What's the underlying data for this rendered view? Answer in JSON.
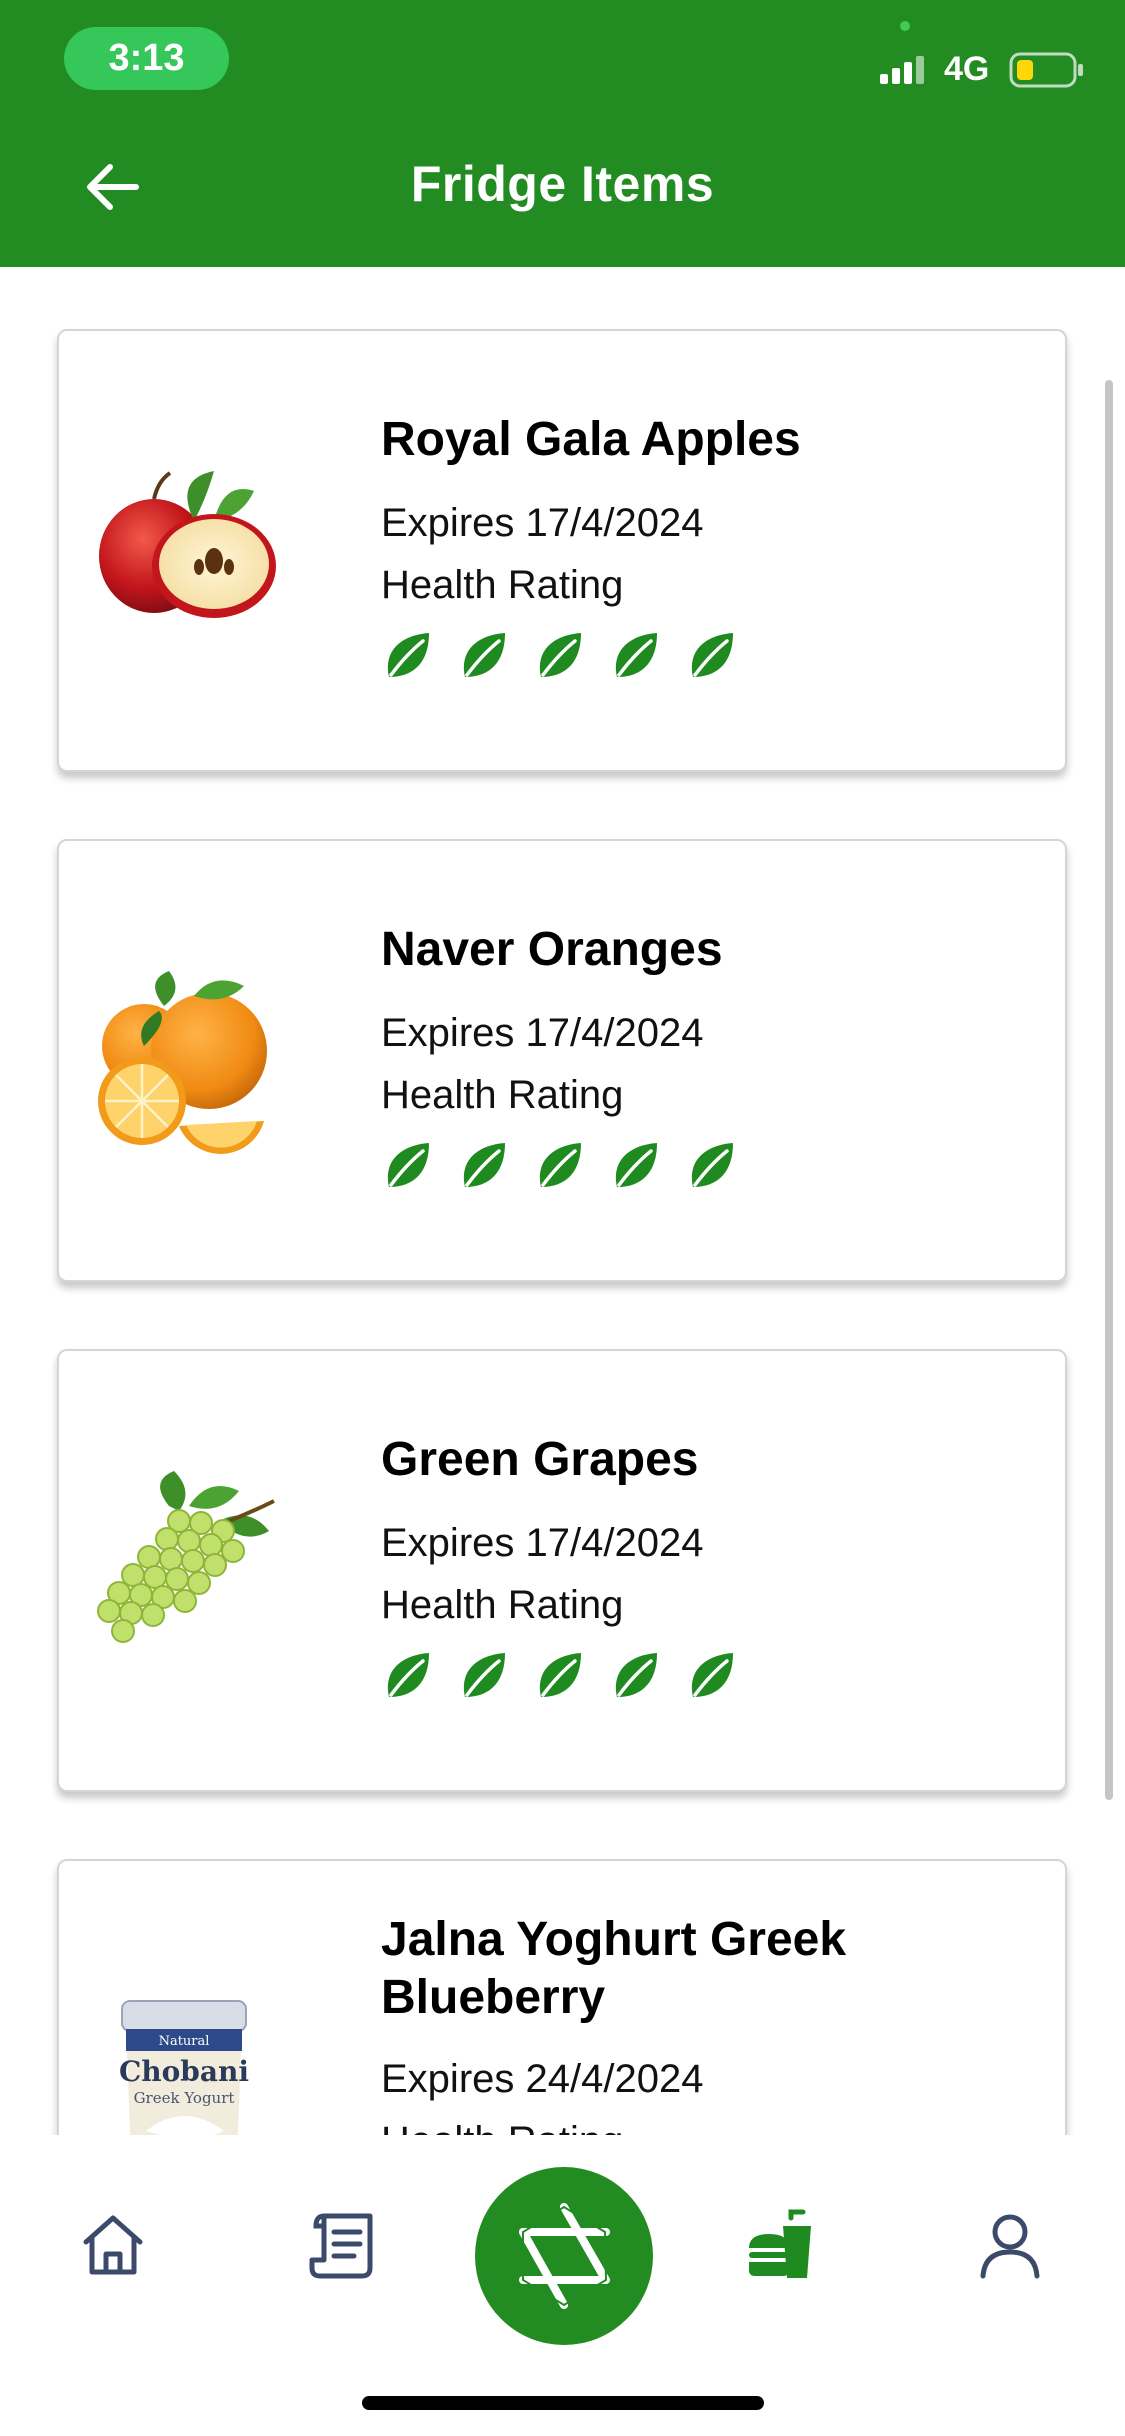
{
  "status_bar": {
    "time": "3:13",
    "network": "4G"
  },
  "header": {
    "title": "Fridge Items"
  },
  "colors": {
    "brand_green": "#228B22",
    "leaf_green": "#1f8a1f",
    "nav_icon": "#3b4a6b"
  },
  "items": [
    {
      "name": "Royal Gala Apples",
      "expires": "Expires 17/4/2024",
      "rating_label": "Health Rating",
      "health_rating": 5,
      "image": "apple-image"
    },
    {
      "name": "Naver Oranges",
      "expires": "Expires 17/4/2024",
      "rating_label": "Health Rating",
      "health_rating": 5,
      "image": "orange-image"
    },
    {
      "name": "Green Grapes",
      "expires": "Expires 17/4/2024",
      "rating_label": "Health Rating",
      "health_rating": 5,
      "image": "grapes-image"
    },
    {
      "name": "Jalna Yoghurt Greek Blueberry",
      "expires": "Expires 24/4/2024",
      "rating_label": "Health Rating",
      "image": "yoghurt-image",
      "yoghurt_brand": "Chobani",
      "yoghurt_tag": "Natural",
      "yoghurt_type": "Greek Yogurt"
    }
  ],
  "bottom_nav": [
    {
      "icon": "home-icon"
    },
    {
      "icon": "receipt-icon"
    },
    {
      "icon": "camera-shutter-icon"
    },
    {
      "icon": "food-icon"
    },
    {
      "icon": "profile-icon"
    }
  ]
}
